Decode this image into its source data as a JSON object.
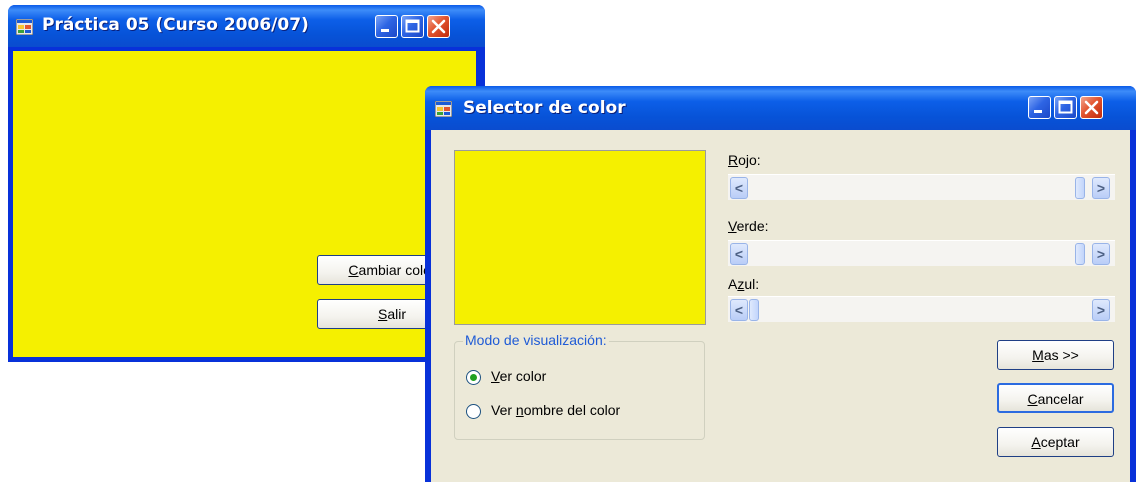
{
  "main_window": {
    "title": "Práctica 05 (Curso 2006/07)",
    "client_color": "#f5f000",
    "buttons": {
      "cambiar_pre": "",
      "cambiar_accel": "C",
      "cambiar_post": "ambiar color",
      "salir_accel": "S",
      "salir_post": "alir"
    }
  },
  "dialog": {
    "title": "Selector de color",
    "preview_color": "#f5f000",
    "sliders": [
      {
        "label_accel": "R",
        "label_post": "ojo:",
        "value_fraction": 1.0
      },
      {
        "label_accel": "V",
        "label_post": "erde:",
        "value_fraction": 1.0
      },
      {
        "label_pre": "A",
        "label_accel": "z",
        "label_post": "ul:",
        "value_fraction": 0.0
      }
    ],
    "mode_group": {
      "title": "Modo de visualización:",
      "options": [
        {
          "accel": "V",
          "post": "er color",
          "selected": true
        },
        {
          "pre": "Ver ",
          "accel": "n",
          "post": "ombre del color",
          "selected": false
        }
      ]
    },
    "buttons": {
      "mas_accel": "M",
      "mas_post": "as >>",
      "cancelar_accel": "C",
      "cancelar_post": "ancelar",
      "aceptar_accel": "A",
      "aceptar_post": "ceptar"
    },
    "arrows": {
      "left": "<",
      "right": ">"
    }
  }
}
